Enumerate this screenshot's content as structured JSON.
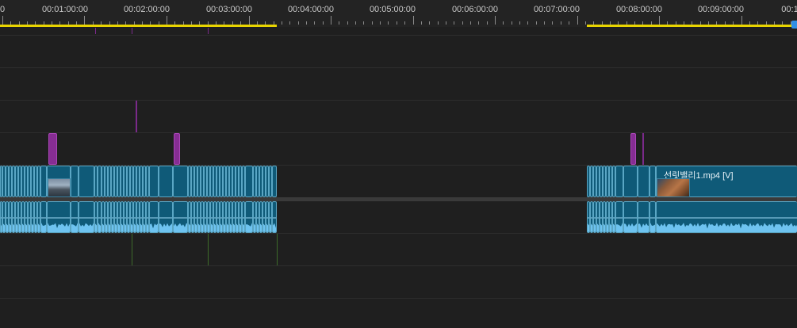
{
  "ruler": {
    "labels": [
      "0",
      "00:01:00:00",
      "00:02:00:00",
      "00:03:00:00",
      "00:04:00:00",
      "00:05:00:00",
      "00:06:00:00",
      "00:07:00:00",
      "00:08:00:00",
      "00:09:00:00",
      "00:1"
    ]
  },
  "clips": {
    "named_clip_title": "선릿밸리1.mp4 [V]"
  },
  "colors": {
    "background": "#1f1f1f",
    "clip_fill": "#0f5a78",
    "clip_border": "#5aa6c4",
    "marker": "#862d93",
    "work_area": "#e8d400",
    "playhead": "#2f8fe8",
    "waveform": "#6ec3f0"
  },
  "icons": {
    "playhead": "playhead-icon",
    "thumbnail": "thumbnail-icon"
  }
}
